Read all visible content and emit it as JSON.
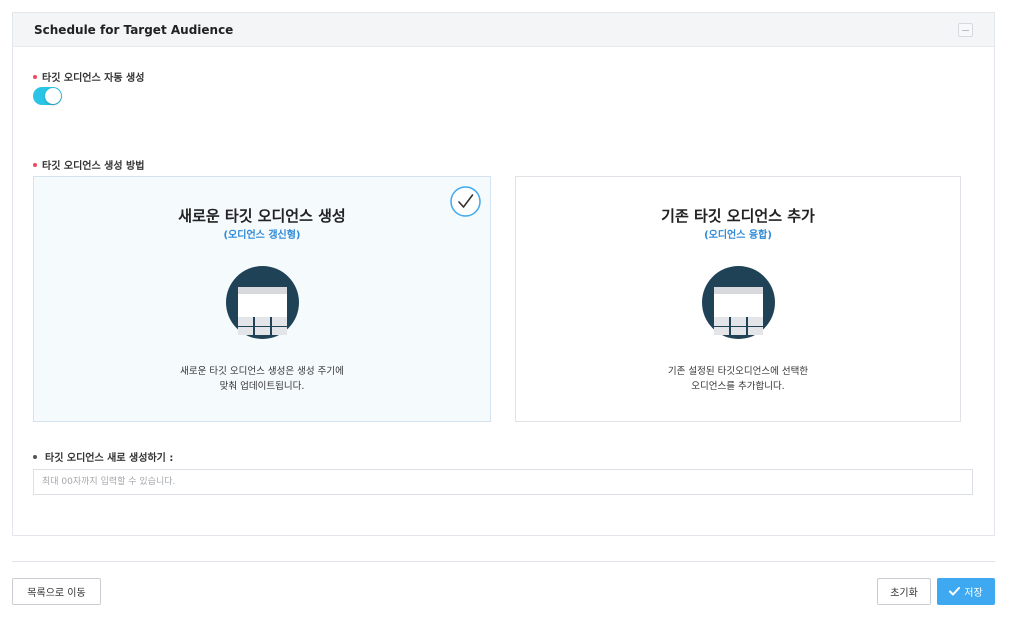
{
  "panel": {
    "title": "Schedule for Target Audience"
  },
  "auto_create": {
    "label": "타깃 오디언스 자동 생성",
    "enabled": true,
    "accent_color": "#29c4e6"
  },
  "method": {
    "label": "타깃 오디언스 생성 방법",
    "options": [
      {
        "title": "새로운 타깃 오디언스 생성",
        "subtitle": "(오디언스 갱신형)",
        "description": "새로운 타깃 오디언스 생성은 생성 주기에\n맞춰 업데이트됩니다.",
        "selected": true
      },
      {
        "title": "기존 타깃 오디언스 추가",
        "subtitle": "(오디언스 융합)",
        "description": "기존 설정된 타깃오디언스에 선택한\n오디언스를 추가합니다.",
        "selected": false
      }
    ]
  },
  "new_audience": {
    "label": "타깃 오디언스 새로 생성하기 :",
    "placeholder": "최대 00자까지 입력할 수 있습니다.",
    "value": ""
  },
  "footer": {
    "back_label": "목록으로 이동",
    "reset_label": "초기화",
    "save_label": "저장"
  },
  "colors": {
    "required_dot": "#ef4a5a",
    "link_blue": "#2f8bd7",
    "save_button": "#3ea9f0",
    "illustration_circle": "#1f4256"
  }
}
